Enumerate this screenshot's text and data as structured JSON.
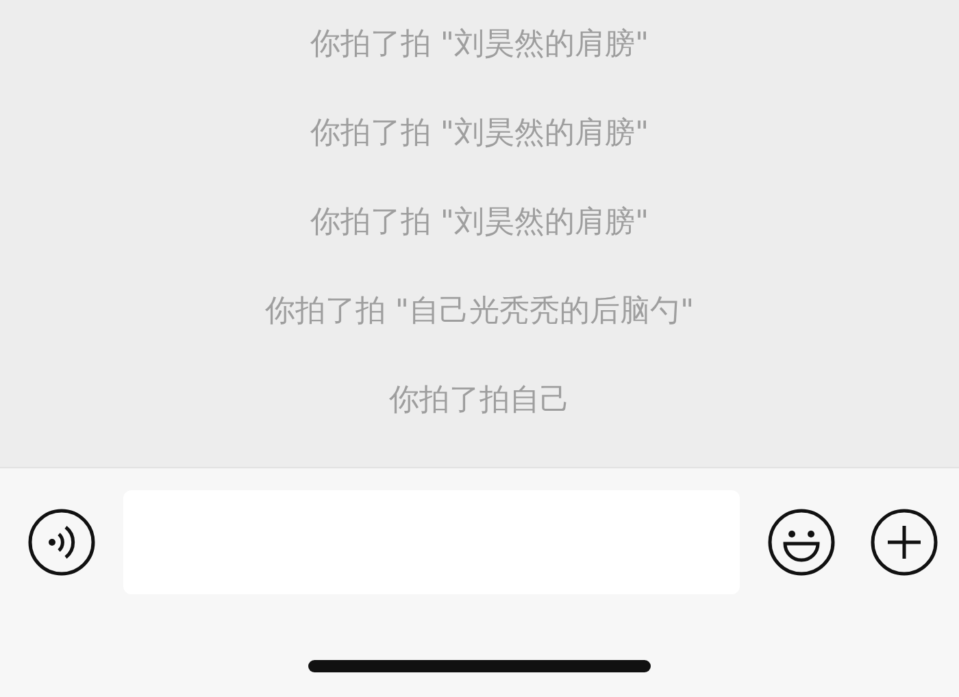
{
  "messages": [
    {
      "text": "你拍了拍 \"刘昊然的肩膀\""
    },
    {
      "text": "你拍了拍 \"刘昊然的肩膀\""
    },
    {
      "text": "你拍了拍 \"刘昊然的肩膀\""
    },
    {
      "text": "你拍了拍 \"自己光秃秃的后脑勺\""
    },
    {
      "text": "你拍了拍自己"
    }
  ]
}
